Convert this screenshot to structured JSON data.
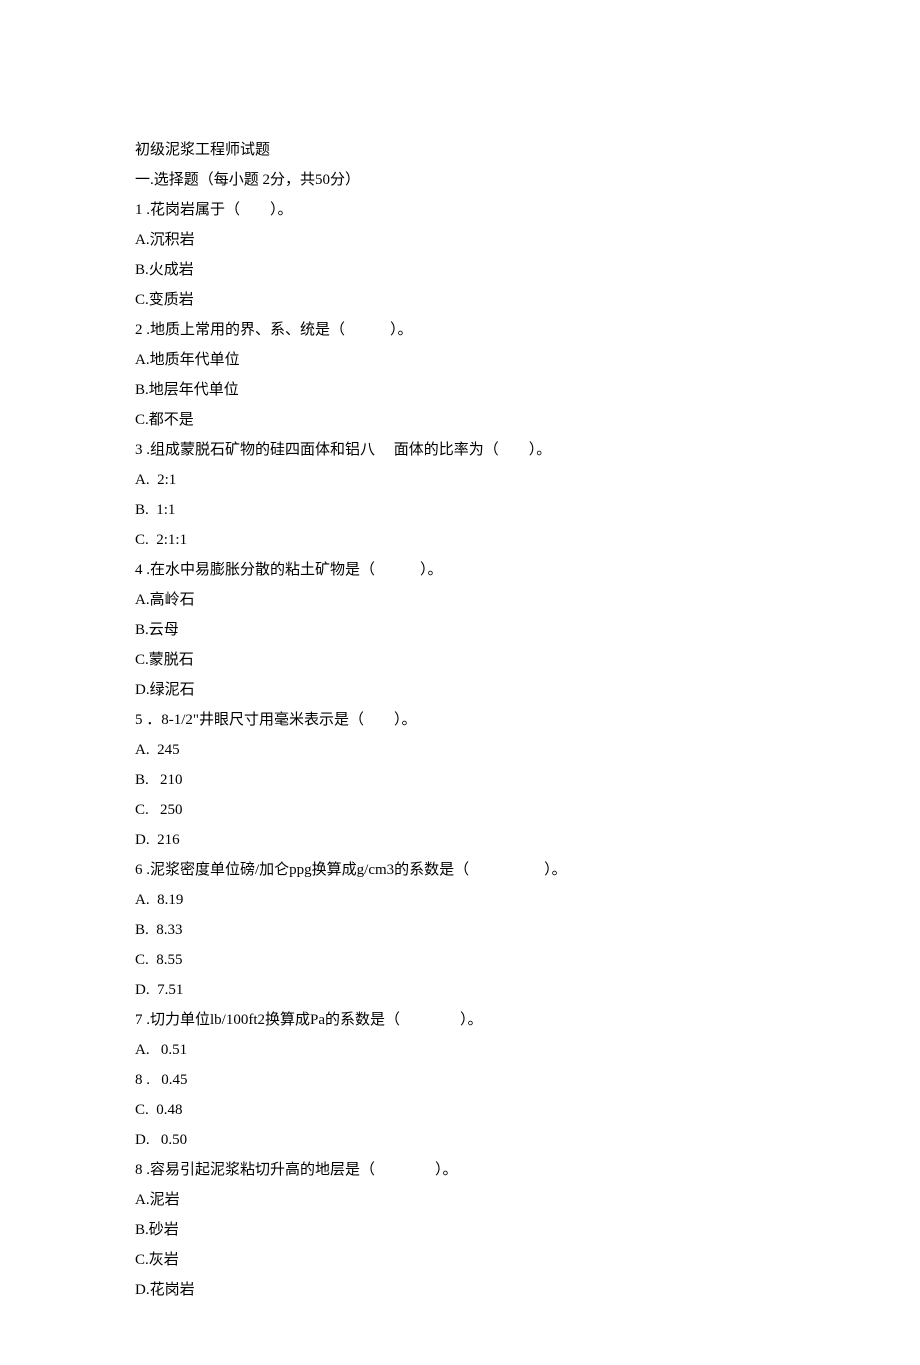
{
  "title": "初级泥浆工程师试题",
  "section_header": "一.选择题（每小题 2分，共50分）",
  "questions": [
    {
      "prompt": "1 .花岗岩属于（　　）。",
      "options": [
        "A.沉积岩",
        "B.火成岩",
        "C.变质岩"
      ]
    },
    {
      "prompt": "2 .地质上常用的界、系、统是（　　　）。",
      "options": [
        "A.地质年代单位",
        "B.地层年代单位",
        "C.都不是"
      ]
    },
    {
      "prompt": "3 .组成蒙脱石矿物的硅四面体和铝八　 面体的比率为（　　）。",
      "options": [
        "A.  2:1",
        "B.  1:1",
        "C.  2:1:1"
      ]
    },
    {
      "prompt": "4 .在水中易膨胀分散的粘土矿物是（　　　）。",
      "options": [
        "A.高岭石",
        "B.云母",
        "C.蒙脱石",
        "D.绿泥石"
      ]
    },
    {
      "prompt": "5 ．8-1/2\"井眼尺寸用毫米表示是（　　）。",
      "options": [
        "A.  245",
        "B.   210",
        "C.   250",
        "D.  216"
      ]
    },
    {
      "prompt": "6 .泥浆密度单位磅/加仑ppg换算成g/cm3的系数是（　　　　　）。",
      "options": [
        "A.  8.19",
        "B.  8.33",
        "C.  8.55",
        "D.  7.51"
      ]
    },
    {
      "prompt": "7 .切力单位lb/100ft2换算成Pa的系数是（　　　　）。",
      "options": [
        "A.   0.51",
        "8 .   0.45",
        "C.  0.48",
        "D.   0.50"
      ]
    },
    {
      "prompt": "8 .容易引起泥浆粘切升高的地层是（　　　　）。",
      "options": [
        "A.泥岩",
        "B.砂岩",
        "C.灰岩",
        "D.花岗岩"
      ]
    }
  ]
}
